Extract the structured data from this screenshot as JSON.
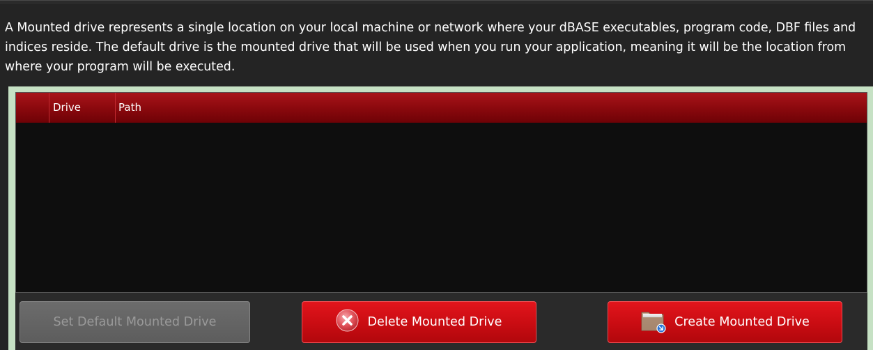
{
  "description": "A Mounted drive represents a single location on your local machine or network where your dBASE executables, program code, DBF files and indices reside. The default drive is the mounted drive that will be used when you run your application, meaning it will be the location from where your program will be executed.",
  "table": {
    "columns": [
      "Drive",
      "Path"
    ],
    "rows": []
  },
  "buttons": {
    "set_default": "Set Default Mounted Drive",
    "delete": "Delete Mounted Drive",
    "create": "Create Mounted Drive"
  },
  "colors": {
    "header_red": "#8c090e",
    "button_red": "#d0141a",
    "panel_green": "#c6e1c4",
    "background": "#242424"
  },
  "icons": {
    "delete": "x-circle-icon",
    "create": "folder-add-icon"
  }
}
